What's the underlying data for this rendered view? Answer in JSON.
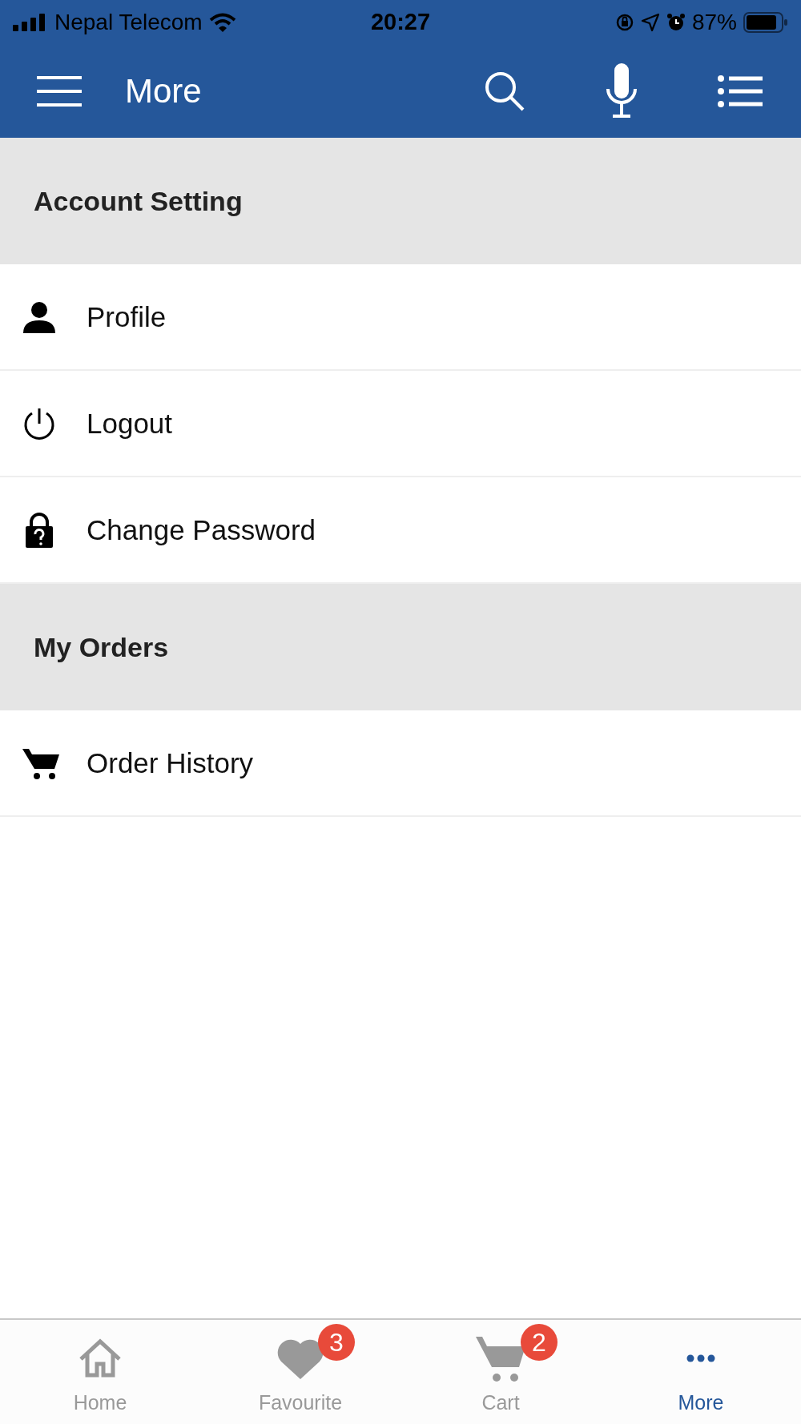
{
  "status_bar": {
    "carrier": "Nepal Telecom",
    "time": "20:27",
    "battery": "87%"
  },
  "header": {
    "title": "More"
  },
  "sections": [
    {
      "title": "Account Setting",
      "items": [
        {
          "kind": "person",
          "label": "Profile"
        },
        {
          "kind": "power",
          "label": "Logout"
        },
        {
          "kind": "lock",
          "label": "Change Password"
        }
      ]
    },
    {
      "title": "My Orders",
      "items": [
        {
          "kind": "cart",
          "label": "Order History"
        }
      ]
    }
  ],
  "tabs": [
    {
      "kind": "home",
      "label": "Home",
      "selected": false
    },
    {
      "kind": "heart",
      "label": "Favourite",
      "selected": false,
      "badge": "3"
    },
    {
      "kind": "cart",
      "label": "Cart",
      "selected": false,
      "badge": "2"
    },
    {
      "kind": "dots",
      "label": "More",
      "selected": true
    }
  ]
}
